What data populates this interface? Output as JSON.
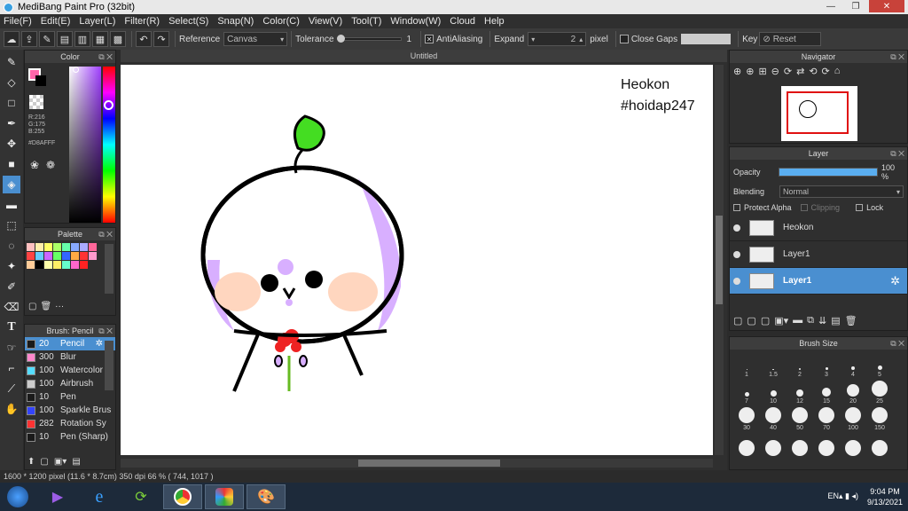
{
  "window": {
    "title": "MediBang Paint Pro (32bit)",
    "min": "—",
    "max": "❐",
    "close": "✕"
  },
  "menu": [
    "File(F)",
    "Edit(E)",
    "Layer(L)",
    "Filter(R)",
    "Select(S)",
    "Snap(N)",
    "Color(C)",
    "View(V)",
    "Tool(T)",
    "Window(W)",
    "Cloud",
    "Help"
  ],
  "toolbar": {
    "reference_label": "Reference",
    "reference_value": "Canvas",
    "tolerance_label": "Tolerance",
    "tolerance_value": "1",
    "antialiasing_label": "AntiAliasing",
    "expand_label": "Expand",
    "expand_value": "2",
    "expand_unit": "pixel",
    "close_gaps_label": "Close Gaps",
    "key_label": "Key",
    "reset_label": "Reset"
  },
  "color_panel": {
    "title": "Color",
    "r": "R:216",
    "g": "G:175",
    "b": "B:255",
    "hex": "#D8AFFF",
    "fg_color": "#D8AFFF",
    "accent_swatch": "#ff66aa"
  },
  "palette_panel": {
    "title": "Palette",
    "add_tip": "···"
  },
  "brush_panel": {
    "title": "Brush: Pencil",
    "items": [
      {
        "size": "20",
        "name": "Pencil",
        "color": "#1a1a1a"
      },
      {
        "size": "300",
        "name": "Blur",
        "color": "#ff88cc"
      },
      {
        "size": "100",
        "name": "Watercolor",
        "color": "#55ddff"
      },
      {
        "size": "100",
        "name": "Airbrush",
        "color": "#cccccc"
      },
      {
        "size": "10",
        "name": "Pen",
        "color": "#1a1a1a"
      },
      {
        "size": "100",
        "name": "Sparkle Brus",
        "color": "#3344ff"
      },
      {
        "size": "282",
        "name": "Rotation Sy",
        "color": "#ff3333"
      },
      {
        "size": "10",
        "name": "Pen (Sharp)",
        "color": "#1a1a1a"
      }
    ]
  },
  "canvas": {
    "tab": "Untitled",
    "text1": "Heokon",
    "text2": "#hoidap247"
  },
  "navigator": {
    "title": "Navigator"
  },
  "layer_panel": {
    "title": "Layer",
    "opacity_label": "Opacity",
    "opacity_value": "100 %",
    "opacity_fraction": 1.0,
    "blending_label": "Blending",
    "blending_value": "Normal",
    "protect_alpha": "Protect Alpha",
    "clipping": "Clipping",
    "lock": "Lock",
    "layers": [
      {
        "name": "Heokon",
        "selected": false
      },
      {
        "name": "Layer1",
        "selected": false
      },
      {
        "name": "Layer1",
        "selected": true
      }
    ]
  },
  "brushsize_panel": {
    "title": "Brush Size",
    "sizes": [
      "1",
      "1.5",
      "2",
      "3",
      "4",
      "5",
      "7",
      "10",
      "12",
      "15",
      "20",
      "25",
      "30",
      "40",
      "50",
      "70",
      "100",
      "150",
      "",
      "",
      "",
      "",
      "",
      ""
    ]
  },
  "status": {
    "text": "1600 * 1200 pixel   (11.6 * 8.7cm)   350 dpi   66 %   ( 744, 1017 )"
  },
  "taskbar": {
    "lang": "EN",
    "time": "9:04 PM",
    "date": "9/13/2021"
  }
}
